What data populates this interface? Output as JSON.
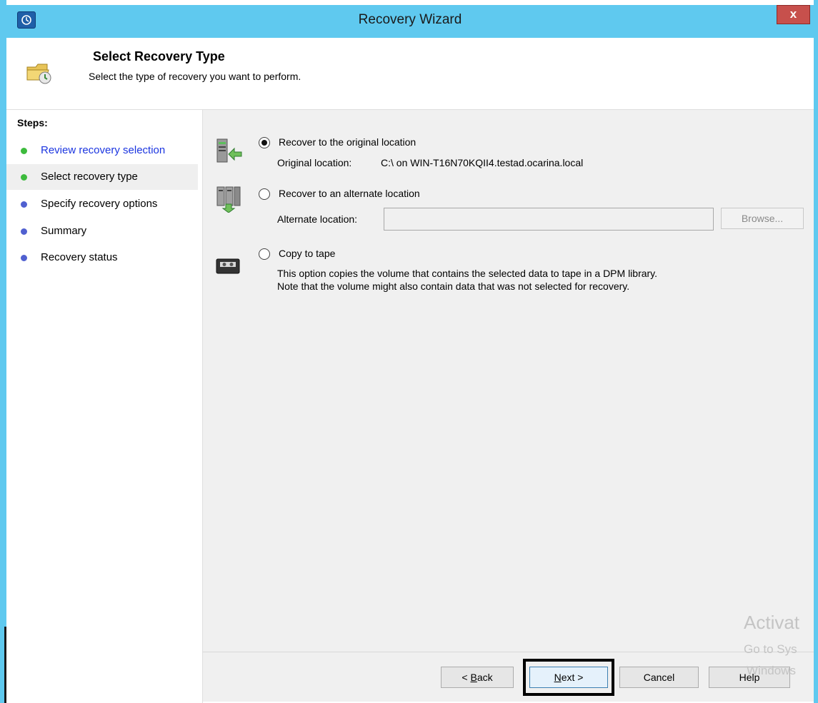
{
  "window": {
    "title": "Recovery Wizard",
    "close_label": "x"
  },
  "header": {
    "title": "Select Recovery Type",
    "subtitle": "Select the type of recovery you want to perform."
  },
  "steps": {
    "heading": "Steps:",
    "items": [
      {
        "label": "Review recovery selection",
        "state": "done",
        "dot_color": "#3dbb3d"
      },
      {
        "label": "Select recovery type",
        "state": "current",
        "dot_color": "#3dbb3d"
      },
      {
        "label": "Specify recovery options",
        "state": "pending",
        "dot_color": "#5060d0"
      },
      {
        "label": "Summary",
        "state": "pending",
        "dot_color": "#5060d0"
      },
      {
        "label": "Recovery status",
        "state": "pending",
        "dot_color": "#5060d0"
      }
    ]
  },
  "options": {
    "original": {
      "label": "Recover to the original location",
      "selected": true,
      "location_label": "Original location:",
      "location_value": "C:\\ on WIN-T16N70KQII4.testad.ocarina.local",
      "icon": "server-restore-icon"
    },
    "alternate": {
      "label": "Recover to an alternate location",
      "selected": false,
      "location_label": "Alternate location:",
      "location_value": "",
      "browse_label": "Browse...",
      "icon": "server-copy-icon"
    },
    "tape": {
      "label": "Copy to tape",
      "selected": false,
      "description_1": "This option copies the volume that contains the selected data to tape in a DPM library.",
      "description_2": "Note that the volume might also contain data that was not selected for recovery.",
      "icon": "tape-icon"
    }
  },
  "footer": {
    "back_accel": "B",
    "back_rest": "ack",
    "next_accel": "N",
    "next_rest": "ext >",
    "cancel_label": "Cancel",
    "help_label": "Help"
  },
  "watermark": {
    "line1": "Activat",
    "line2": "Go to Sys",
    "line3": "Windows"
  },
  "colors": {
    "titlebar": "#5fc9ef",
    "close": "#c7504c",
    "link": "#1b35e0"
  }
}
